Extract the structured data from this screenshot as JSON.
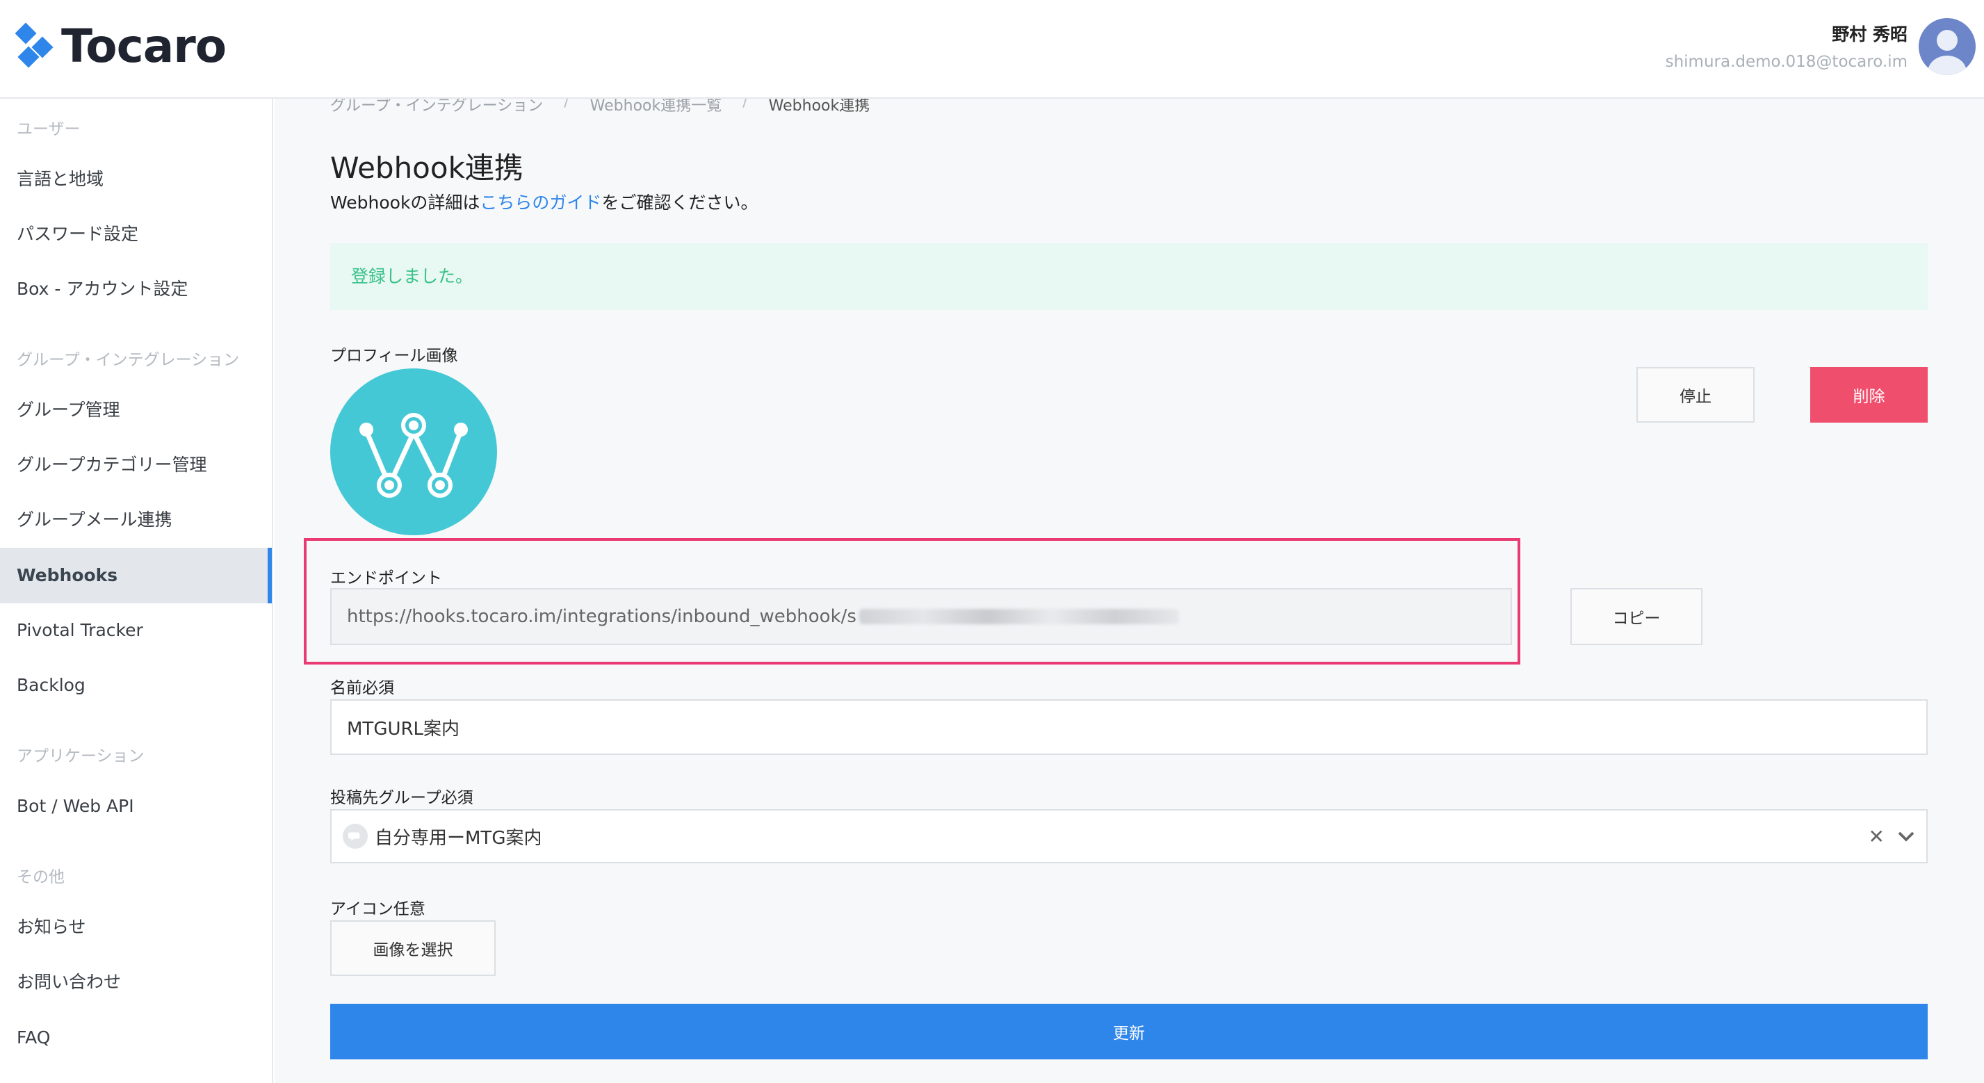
{
  "header": {
    "logo_text": "Tocaro",
    "user_name": "野村 秀昭",
    "user_email": "shimura.demo.018@tocaro.im"
  },
  "sidebar": {
    "sections": [
      {
        "title": "ユーザー",
        "items": [
          "言語と地域",
          "パスワード設定",
          "Box - アカウント設定"
        ]
      },
      {
        "title": "グループ・インテグレーション",
        "items": [
          "グループ管理",
          "グループカテゴリー管理",
          "グループメール連携",
          "Webhooks",
          "Pivotal Tracker",
          "Backlog"
        ]
      },
      {
        "title": "アプリケーション",
        "items": [
          "Bot / Web API"
        ]
      },
      {
        "title": "その他",
        "items": [
          "お知らせ",
          "お問い合わせ",
          "FAQ"
        ]
      }
    ],
    "active": "Webhooks"
  },
  "breadcrumb": {
    "items": [
      "グループ・インテグレーション",
      "Webhook連携一覧",
      "Webhook連携"
    ],
    "separator": "/"
  },
  "page": {
    "title": "Webhook連携",
    "desc_prefix": "Webhookの詳細は",
    "desc_link": "こちらのガイド",
    "desc_suffix": "をご確認ください。",
    "alert": "登録しました。"
  },
  "form": {
    "profile_label": "プロフィール画像",
    "stop_button": "停止",
    "delete_button": "削除",
    "endpoint_label": "エンドポイント",
    "endpoint_value": "https://hooks.tocaro.im/integrations/inbound_webhook/s",
    "copy_button": "コピー",
    "name_label": "名前必須",
    "name_value": "MTGURL案内",
    "group_label": "投稿先グループ必須",
    "group_value": "自分専用ーMTG案内",
    "icon_label": "アイコン任意",
    "choose_image_button": "画像を選択",
    "submit_button": "更新"
  },
  "colors": {
    "accent": "#2f86ea",
    "danger": "#f04e6d",
    "success_text": "#37c189",
    "success_bg": "#e8f8f2",
    "highlight": "#ea3a73",
    "profile_bg": "#45c8d6"
  }
}
